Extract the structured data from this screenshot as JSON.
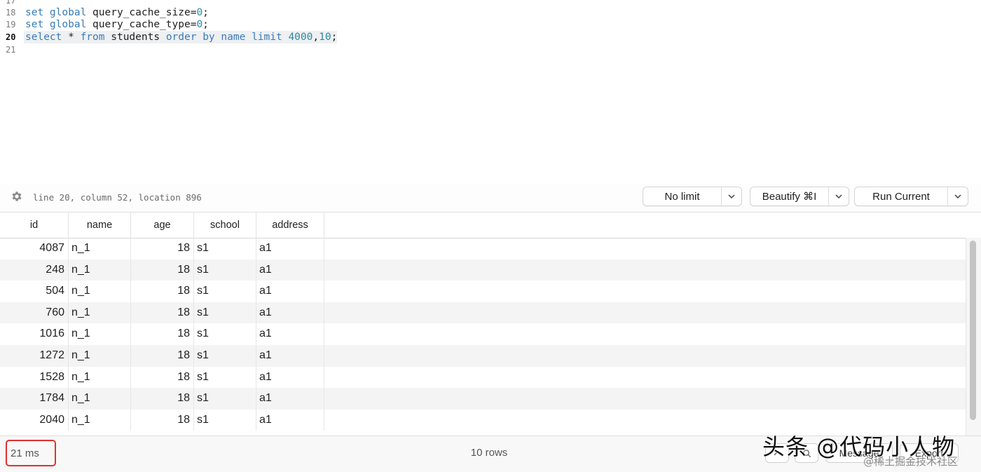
{
  "editor": {
    "lines": [
      {
        "no": "17",
        "tokens": []
      },
      {
        "no": "18",
        "tokens": [
          [
            "kw",
            "set "
          ],
          [
            "kw",
            "global "
          ],
          [
            "id",
            "query_cache_size="
          ],
          [
            "num",
            "0"
          ],
          [
            "id",
            ";"
          ]
        ]
      },
      {
        "no": "19",
        "tokens": [
          [
            "kw",
            "set "
          ],
          [
            "kw",
            "global "
          ],
          [
            "id",
            "query_cache_type="
          ],
          [
            "num",
            "0"
          ],
          [
            "id",
            ";"
          ]
        ]
      },
      {
        "no": "20",
        "active": true,
        "tokens": [
          [
            "kw",
            "select "
          ],
          [
            "id",
            "* "
          ],
          [
            "kw",
            "from "
          ],
          [
            "id",
            "students "
          ],
          [
            "kw",
            "order "
          ],
          [
            "kw",
            "by "
          ],
          [
            "kw",
            "name "
          ],
          [
            "kw",
            "limit "
          ],
          [
            "num",
            "4000"
          ],
          [
            "id",
            ","
          ],
          [
            "num",
            "10"
          ],
          [
            "id",
            ";"
          ]
        ]
      },
      {
        "no": "21",
        "tokens": []
      }
    ]
  },
  "toolbar": {
    "gear_icon": "gear-icon",
    "cursor_info": "line 20, column 52, location 896",
    "limit_label": "No limit",
    "beautify_label": "Beautify ⌘I",
    "run_label": "Run Current"
  },
  "grid": {
    "columns": [
      "id",
      "name",
      "age",
      "school",
      "address"
    ],
    "rows": [
      [
        "4087",
        "n_1",
        "18",
        "s1",
        "a1"
      ],
      [
        "248",
        "n_1",
        "18",
        "s1",
        "a1"
      ],
      [
        "504",
        "n_1",
        "18",
        "s1",
        "a1"
      ],
      [
        "760",
        "n_1",
        "18",
        "s1",
        "a1"
      ],
      [
        "1016",
        "n_1",
        "18",
        "s1",
        "a1"
      ],
      [
        "1272",
        "n_1",
        "18",
        "s1",
        "a1"
      ],
      [
        "1528",
        "n_1",
        "18",
        "s1",
        "a1"
      ],
      [
        "1784",
        "n_1",
        "18",
        "s1",
        "a1"
      ],
      [
        "2040",
        "n_1",
        "18",
        "s1",
        "a1"
      ]
    ]
  },
  "status": {
    "duration": "21 ms",
    "row_count": "10 rows",
    "message_label": "Message",
    "export_label": "Export"
  },
  "watermark": {
    "main": "头条 @代码小人物",
    "sub": "@稀土掘金技术社区"
  },
  "colors": {
    "keyword": "#3a7bb8",
    "number": "#2c8aa0",
    "highlight_border": "#e03030"
  }
}
